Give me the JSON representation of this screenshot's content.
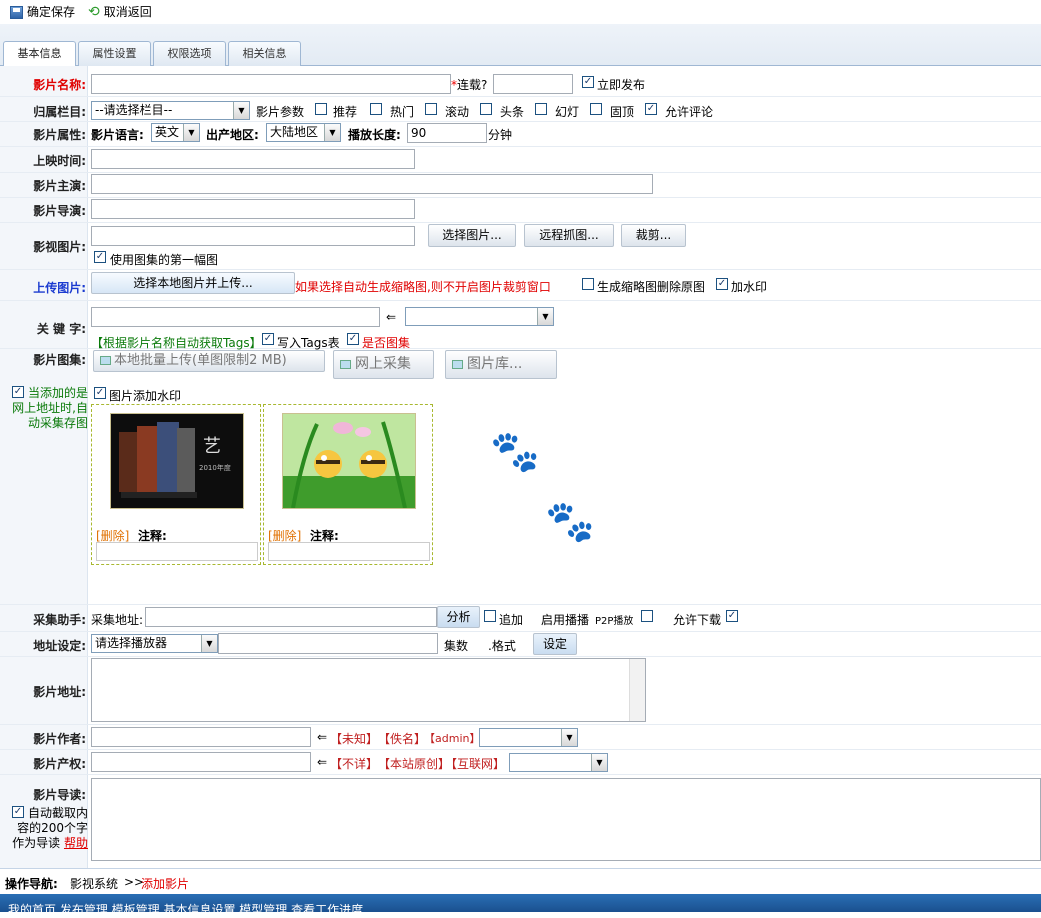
{
  "toolbar": {
    "save_label": "确定保存",
    "cancel_label": "取消返回"
  },
  "tabs": [
    {
      "label": "基本信息",
      "active": true
    },
    {
      "label": "属性设置",
      "active": false
    },
    {
      "label": "权限选项",
      "active": false
    },
    {
      "label": "相关信息",
      "active": false
    }
  ],
  "title_row": {
    "label": "影片名称:",
    "serial_label": "连载?",
    "publish_label": "立即发布",
    "publish_checked": true
  },
  "column_row": {
    "label": "归属栏目:",
    "column_select": "--请选择栏目--",
    "params_label": "影片参数",
    "params": [
      {
        "label": "推荐",
        "checked": false
      },
      {
        "label": "热门",
        "checked": false
      },
      {
        "label": "滚动",
        "checked": false
      },
      {
        "label": "头条",
        "checked": false
      },
      {
        "label": "幻灯",
        "checked": false
      },
      {
        "label": "固顶",
        "checked": false
      },
      {
        "label": "允许评论",
        "checked": true
      }
    ]
  },
  "attr_row": {
    "label": "影片属性:",
    "lang_label": "影片语言:",
    "lang_value": "英文",
    "region_label": "出产地区:",
    "region_value": "大陆地区",
    "length_label": "播放长度:",
    "length_value": "90",
    "length_unit": "分钟"
  },
  "release_row": {
    "label": "上映时间:"
  },
  "actor_row": {
    "label": "影片主演:"
  },
  "director_row": {
    "label": "影片导演:"
  },
  "image_row": {
    "label": "影视图片:",
    "choose_btn": "选择图片...",
    "remote_btn": "远程抓图...",
    "crop_btn": "裁剪...",
    "use_first_label": "使用图集的第一幅图",
    "use_first_checked": true
  },
  "upload_row": {
    "label": "上传图片:",
    "upload_btn": "选择本地图片并上传...",
    "hint": "如果选择自动生成缩略图,则不开启图片裁剪窗口",
    "delete_original_label": "生成缩略图删除原图",
    "delete_original_checked": false,
    "watermark_label": "加水印",
    "watermark_checked": true
  },
  "keyword_row": {
    "label": "关 键 字:",
    "arrow": "⇐",
    "auto_tags_label": "【根据影片名称自动获取Tags】",
    "write_tags_label": "写入Tags表",
    "write_tags_checked": true,
    "is_atlas_label": "是否图集",
    "is_atlas_checked": true
  },
  "gallery_row": {
    "label": "影片图集:",
    "local_btn": "本地批量上传(单图限制2 MB)",
    "web_btn": "网上采集",
    "lib_btn": "图片库...",
    "side_checkbox_label": "当添加的是网上地址时,自动采集存图",
    "side_checked": true,
    "watermark_label": "图片添加水印",
    "watermark_checked": true,
    "items": [
      {
        "delete_label": "[删除]",
        "note_label": "注释:"
      },
      {
        "delete_label": "[删除]",
        "note_label": "注释:"
      }
    ]
  },
  "collect_row": {
    "label": "采集助手:",
    "url_label": "采集地址:",
    "analyze_btn": "分析",
    "append_label": "追加",
    "append_checked": false,
    "player_label": "启用播播",
    "p2p_label": "P2P播放",
    "p2p_checked": false,
    "download_label": "允许下载",
    "download_checked": true
  },
  "address_row": {
    "label": "地址设定:",
    "player_select": "请选择播放器",
    "episodes_label": "集数",
    "format_label": ".格式",
    "set_btn": "设定"
  },
  "url_row": {
    "label": "影片地址:"
  },
  "author_row": {
    "label": "影片作者:",
    "arrow": "⇐",
    "opt1": "【未知】",
    "opt2": "【佚名】",
    "opt3": "【admin】"
  },
  "copyright_row": {
    "label": "影片产权:",
    "arrow": "⇐",
    "opt1": "【不详】",
    "opt2": "【本站原创】",
    "opt3": "【互联网】"
  },
  "intro_row": {
    "label": "影片导读:",
    "auto_label": "自动截取内容的200个字作为导读",
    "auto_checked": true,
    "help_link": "帮助"
  },
  "nav": {
    "label": "操作导航:",
    "path1": "影视系统",
    "sep": ">>",
    "path2": "添加影片"
  },
  "bottom_menu": "我的首页  发布管理  模板管理  基本信息设置  模型管理  查看工作进度"
}
